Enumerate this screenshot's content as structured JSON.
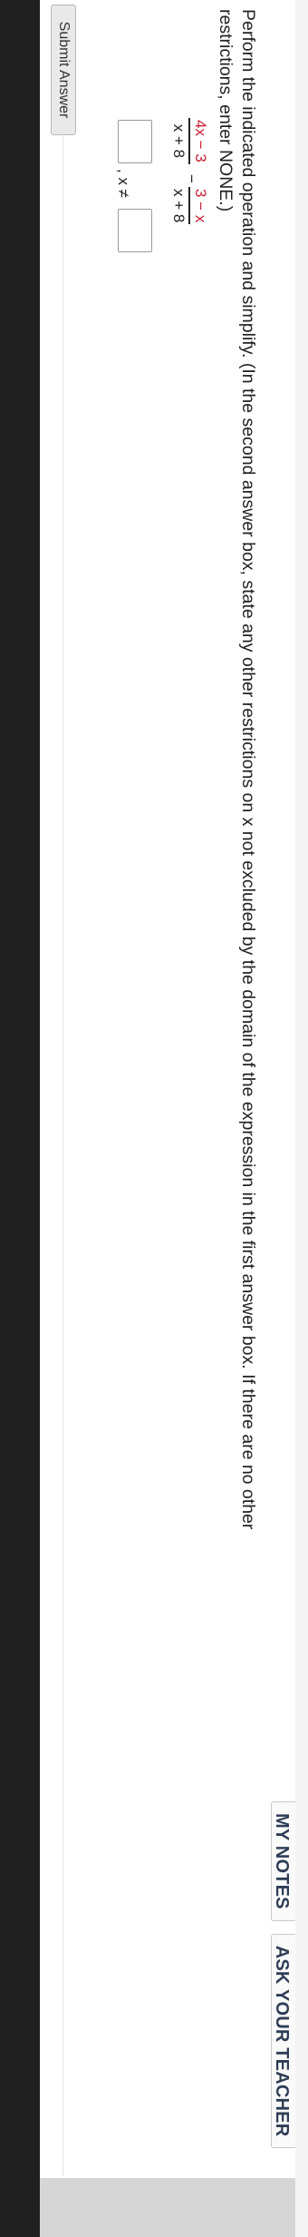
{
  "header": {
    "my_notes_label": "MY NOTES",
    "ask_teacher_label": "ASK YOUR TEACHER"
  },
  "question": {
    "line1": "Perform the indicated operation and simplify. (In the second answer box, state any other restrictions on x not excluded by the domain of the expression in the first answer box. If there are no other",
    "line2": "restrictions, enter NONE.)"
  },
  "expression": {
    "frac1_num": "4x − 3",
    "frac1_den": "x + 8",
    "operator": "−",
    "frac2_num": "3 − x",
    "frac2_den": "x + 8"
  },
  "answer": {
    "separator": ", x ≠"
  },
  "submit_label": "Submit Answer"
}
